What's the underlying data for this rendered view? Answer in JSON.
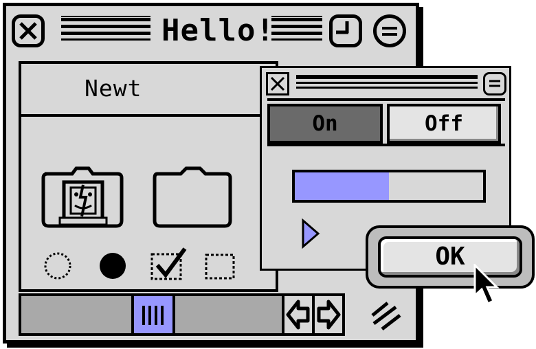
{
  "main_window": {
    "title": "Hello!",
    "name_field_value": "Newt",
    "checkbox_states": [
      "empty",
      "filled",
      "checked",
      "empty"
    ]
  },
  "sub_window": {
    "segmented": [
      {
        "label": "On",
        "selected": true
      },
      {
        "label": "Off",
        "selected": false
      }
    ],
    "progress": 0.5
  },
  "dialog": {
    "ok_label": "OK"
  },
  "colors": {
    "accent": "#9797ff",
    "window_bg": "#d8d8d8",
    "selected_segment": "#6a6a6a"
  },
  "icons": [
    "close-icon",
    "zoom-icon",
    "collapse-icon",
    "finder-icon",
    "folder-icon",
    "arrow-left-icon",
    "arrow-right-icon",
    "resize-grip-icon",
    "play-icon",
    "cursor-icon"
  ]
}
